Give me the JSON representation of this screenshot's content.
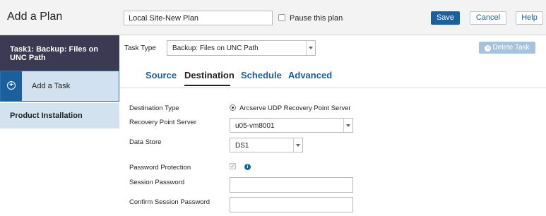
{
  "header": {
    "title": "Add a Plan",
    "plan_name_value": "Local Site-New Plan",
    "pause_label": "Pause this plan",
    "save_label": "Save",
    "cancel_label": "Cancel",
    "help_label": "Help"
  },
  "sidebar": {
    "task_item": "Task1: Backup: Files on UNC Path",
    "add_task": "Add a Task",
    "product_installation": "Product Installation"
  },
  "task": {
    "type_label": "Task Type",
    "type_value": "Backup: Files on UNC Path",
    "delete_label": "Delete Task"
  },
  "tabs": [
    {
      "label": "Source"
    },
    {
      "label": "Destination"
    },
    {
      "label": "Schedule"
    },
    {
      "label": "Advanced"
    }
  ],
  "form": {
    "destination_type_label": "Destination Type",
    "destination_type_value": "Arcserve UDP Recovery Point Server",
    "rps_label": "Recovery Point Server",
    "rps_value": "u05-vm8001",
    "data_store_label": "Data Store",
    "data_store_value": "DS1",
    "password_protection_label": "Password Protection",
    "session_password_label": "Session Password",
    "confirm_password_label": "Confirm Session Password"
  },
  "colors": {
    "primary": "#1a5f9e",
    "sidebar_active": "#3c3a52",
    "sidebar_light": "#d3e2ef"
  }
}
